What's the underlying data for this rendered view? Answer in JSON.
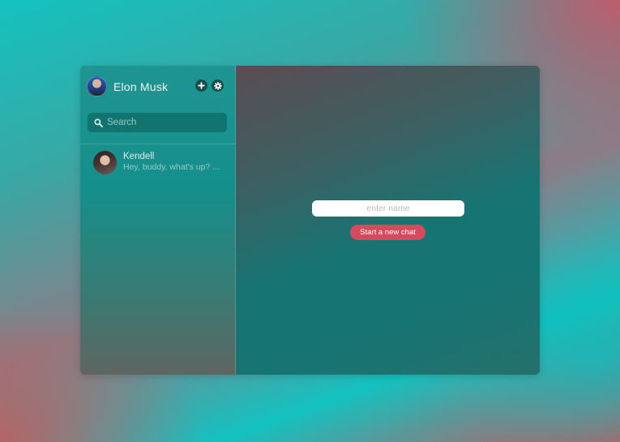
{
  "profile": {
    "name": "Elon Musk",
    "avatar_icon": "user-avatar-photo"
  },
  "header_actions": {
    "add_icon": "plus-icon",
    "settings_icon": "gear-icon"
  },
  "search": {
    "placeholder": "Search",
    "icon": "search-icon"
  },
  "chats": [
    {
      "name": "Kendell",
      "preview": "Hey, buddy, what's up? ..."
    }
  ],
  "new_chat": {
    "name_placeholder": "enter name",
    "start_button_label": "Start a new chat"
  },
  "colors": {
    "accent": "#d9495e",
    "sidebar": "#1f9592",
    "icon_button_bg": "#174e4c"
  }
}
